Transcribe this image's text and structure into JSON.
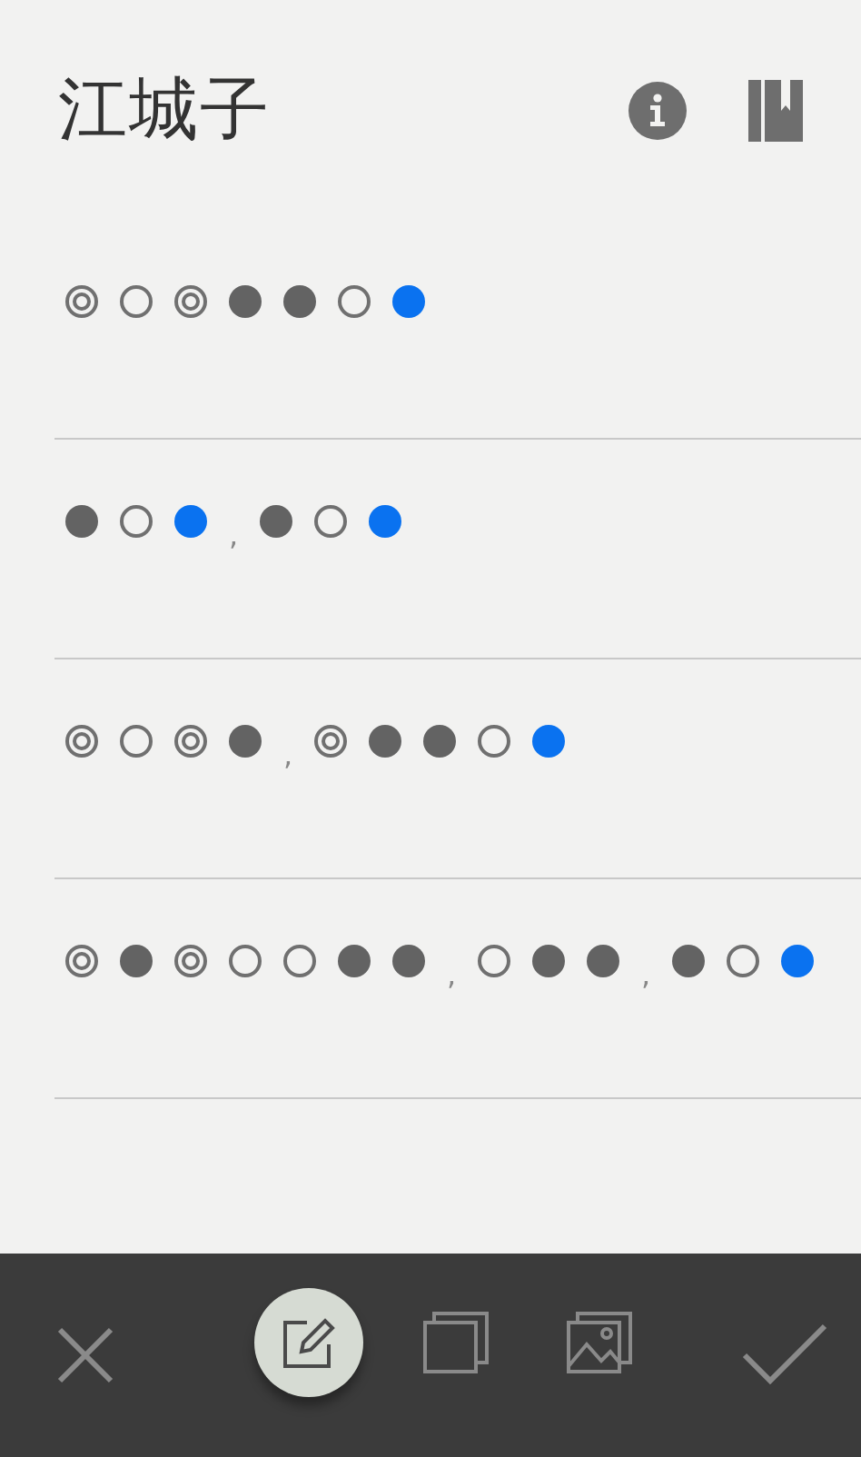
{
  "title": "江城子",
  "lines": [
    {
      "marks": [
        {
          "kind": "either"
        },
        {
          "kind": "level"
        },
        {
          "kind": "either"
        },
        {
          "kind": "oblique"
        },
        {
          "kind": "oblique"
        },
        {
          "kind": "level"
        },
        {
          "kind": "rhyme"
        }
      ]
    },
    {
      "marks": [
        {
          "kind": "oblique"
        },
        {
          "kind": "level"
        },
        {
          "kind": "rhyme"
        },
        {
          "kind": "comma",
          "text": ","
        },
        {
          "kind": "oblique"
        },
        {
          "kind": "level"
        },
        {
          "kind": "rhyme"
        }
      ]
    },
    {
      "marks": [
        {
          "kind": "either"
        },
        {
          "kind": "level"
        },
        {
          "kind": "either"
        },
        {
          "kind": "oblique"
        },
        {
          "kind": "comma",
          "text": ","
        },
        {
          "kind": "either"
        },
        {
          "kind": "oblique"
        },
        {
          "kind": "oblique"
        },
        {
          "kind": "level"
        },
        {
          "kind": "rhyme"
        }
      ]
    },
    {
      "marks": [
        {
          "kind": "either"
        },
        {
          "kind": "oblique"
        },
        {
          "kind": "either"
        },
        {
          "kind": "level"
        },
        {
          "kind": "level"
        },
        {
          "kind": "oblique"
        },
        {
          "kind": "oblique"
        },
        {
          "kind": "comma",
          "text": ","
        },
        {
          "kind": "level"
        },
        {
          "kind": "oblique"
        },
        {
          "kind": "oblique"
        },
        {
          "kind": "comma",
          "text": ","
        },
        {
          "kind": "oblique"
        },
        {
          "kind": "level"
        },
        {
          "kind": "rhyme"
        }
      ]
    }
  ],
  "tools": [
    {
      "kind": "close",
      "selected": false
    },
    {
      "kind": "edit",
      "selected": true
    },
    {
      "kind": "copy",
      "selected": false
    },
    {
      "kind": "image",
      "selected": false
    },
    {
      "kind": "confirm",
      "selected": false
    }
  ]
}
